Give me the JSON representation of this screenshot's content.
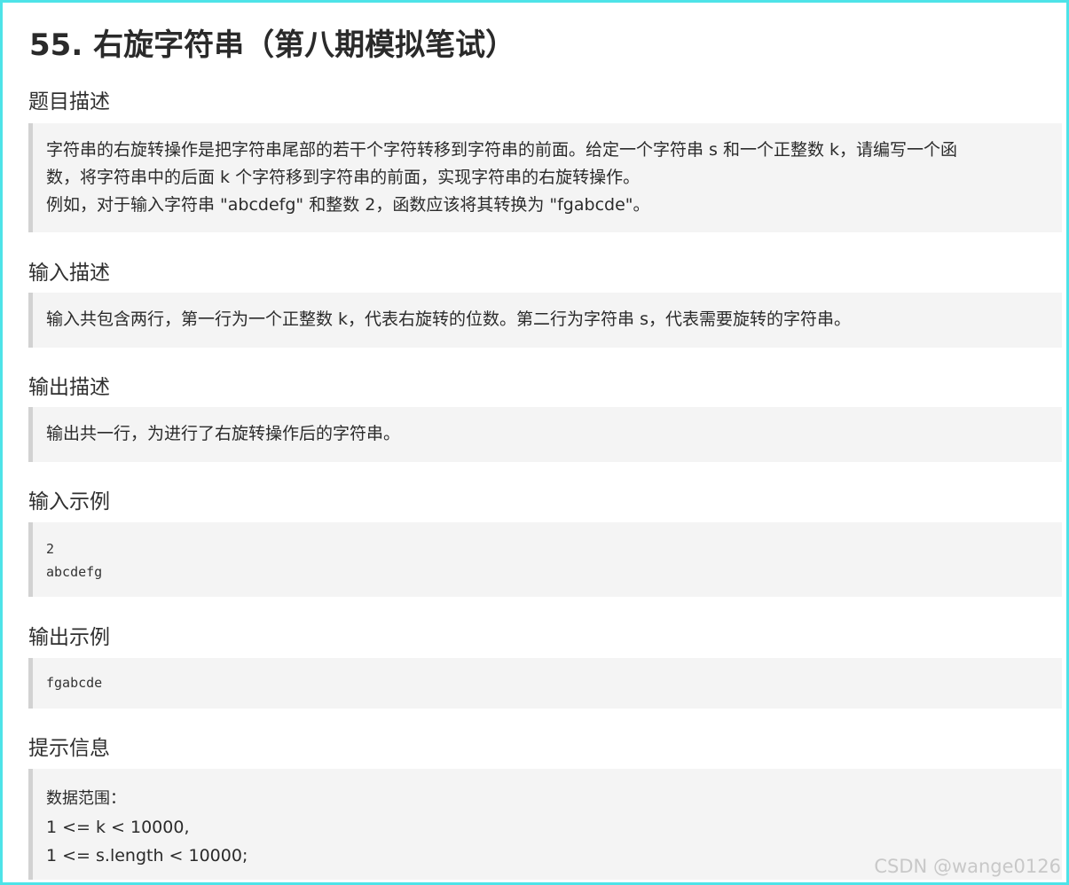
{
  "title": "55. 右旋字符串（第八期模拟笔试）",
  "sections": {
    "description": {
      "heading": "题目描述",
      "lines": [
        "字符串的右旋转操作是把字符串尾部的若干个字符转移到字符串的前面。给定一个字符串 s 和一个正整数 k，请编写一个函",
        "数，将字符串中的后面 k 个字符移到字符串的前面，实现字符串的右旋转操作。",
        "例如，对于输入字符串 \"abcdefg\" 和整数 2，函数应该将其转换为 \"fgabcde\"。"
      ]
    },
    "input_desc": {
      "heading": "输入描述",
      "lines": [
        "输入共包含两行，第一行为一个正整数 k，代表右旋转的位数。第二行为字符串 s，代表需要旋转的字符串。"
      ]
    },
    "output_desc": {
      "heading": "输出描述",
      "lines": [
        "输出共一行，为进行了右旋转操作后的字符串。"
      ]
    },
    "input_example": {
      "heading": "输入示例",
      "lines": [
        "2",
        "abcdefg"
      ]
    },
    "output_example": {
      "heading": "输出示例",
      "lines": [
        "fgabcde"
      ]
    },
    "hint": {
      "heading": "提示信息",
      "lines": [
        "数据范围：",
        "1 <= k < 10000,",
        "1 <= s.length < 10000;"
      ]
    }
  },
  "watermark": "CSDN @wange0126",
  "colors": {
    "frame_border": "#4de3e8",
    "block_background": "#f4f4f4",
    "block_border": "#d2d2d2"
  }
}
